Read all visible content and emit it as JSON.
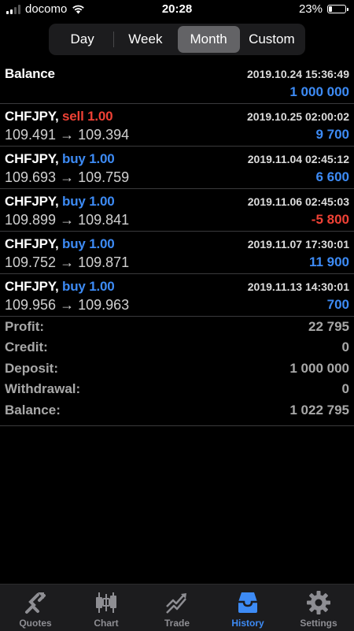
{
  "status": {
    "carrier": "docomo",
    "time": "20:28",
    "battery": "23%",
    "battery_level": 0.23
  },
  "segments": [
    {
      "label": "Day",
      "active": false
    },
    {
      "label": "Week",
      "active": false
    },
    {
      "label": "Month",
      "active": true
    },
    {
      "label": "Custom",
      "active": false
    }
  ],
  "balance_row": {
    "title": "Balance",
    "datetime": "2019.10.24 15:36:49",
    "amount": "1 000 000"
  },
  "deals": [
    {
      "symbol": "CHFJPY,",
      "side": "sell 1.00",
      "side_type": "sell",
      "prices": "109.491 → 109.394",
      "datetime": "2019.10.25 02:00:02",
      "profit": "9 700",
      "profit_sign": "pos"
    },
    {
      "symbol": "CHFJPY,",
      "side": "buy 1.00",
      "side_type": "buy",
      "prices": "109.693 → 109.759",
      "datetime": "2019.11.04 02:45:12",
      "profit": "6 600",
      "profit_sign": "pos"
    },
    {
      "symbol": "CHFJPY,",
      "side": "buy 1.00",
      "side_type": "buy",
      "prices": "109.899 → 109.841",
      "datetime": "2019.11.06 02:45:03",
      "profit": "-5 800",
      "profit_sign": "neg"
    },
    {
      "symbol": "CHFJPY,",
      "side": "buy 1.00",
      "side_type": "buy",
      "prices": "109.752 → 109.871",
      "datetime": "2019.11.07 17:30:01",
      "profit": "11 900",
      "profit_sign": "pos"
    },
    {
      "symbol": "CHFJPY,",
      "side": "buy 1.00",
      "side_type": "buy",
      "prices": "109.956 → 109.963",
      "datetime": "2019.11.13 14:30:01",
      "profit": "700",
      "profit_sign": "pos"
    }
  ],
  "summary": [
    {
      "label": "Profit:",
      "value": "22 795"
    },
    {
      "label": "Credit:",
      "value": "0"
    },
    {
      "label": "Deposit:",
      "value": "1 000 000"
    },
    {
      "label": "Withdrawal:",
      "value": "0"
    },
    {
      "label": "Balance:",
      "value": "1 022 795"
    }
  ],
  "tabs": [
    {
      "label": "Quotes",
      "icon": "quotes-icon",
      "active": false
    },
    {
      "label": "Chart",
      "icon": "chart-icon",
      "active": false
    },
    {
      "label": "Trade",
      "icon": "trade-icon",
      "active": false
    },
    {
      "label": "History",
      "icon": "history-icon",
      "active": true
    },
    {
      "label": "Settings",
      "icon": "settings-icon",
      "active": false
    }
  ],
  "colors": {
    "buy": "#3d8bf5",
    "sell": "#ef4135",
    "positive": "#3d8bf5",
    "negative": "#ef4135",
    "active_tab": "#3d8bf5"
  }
}
